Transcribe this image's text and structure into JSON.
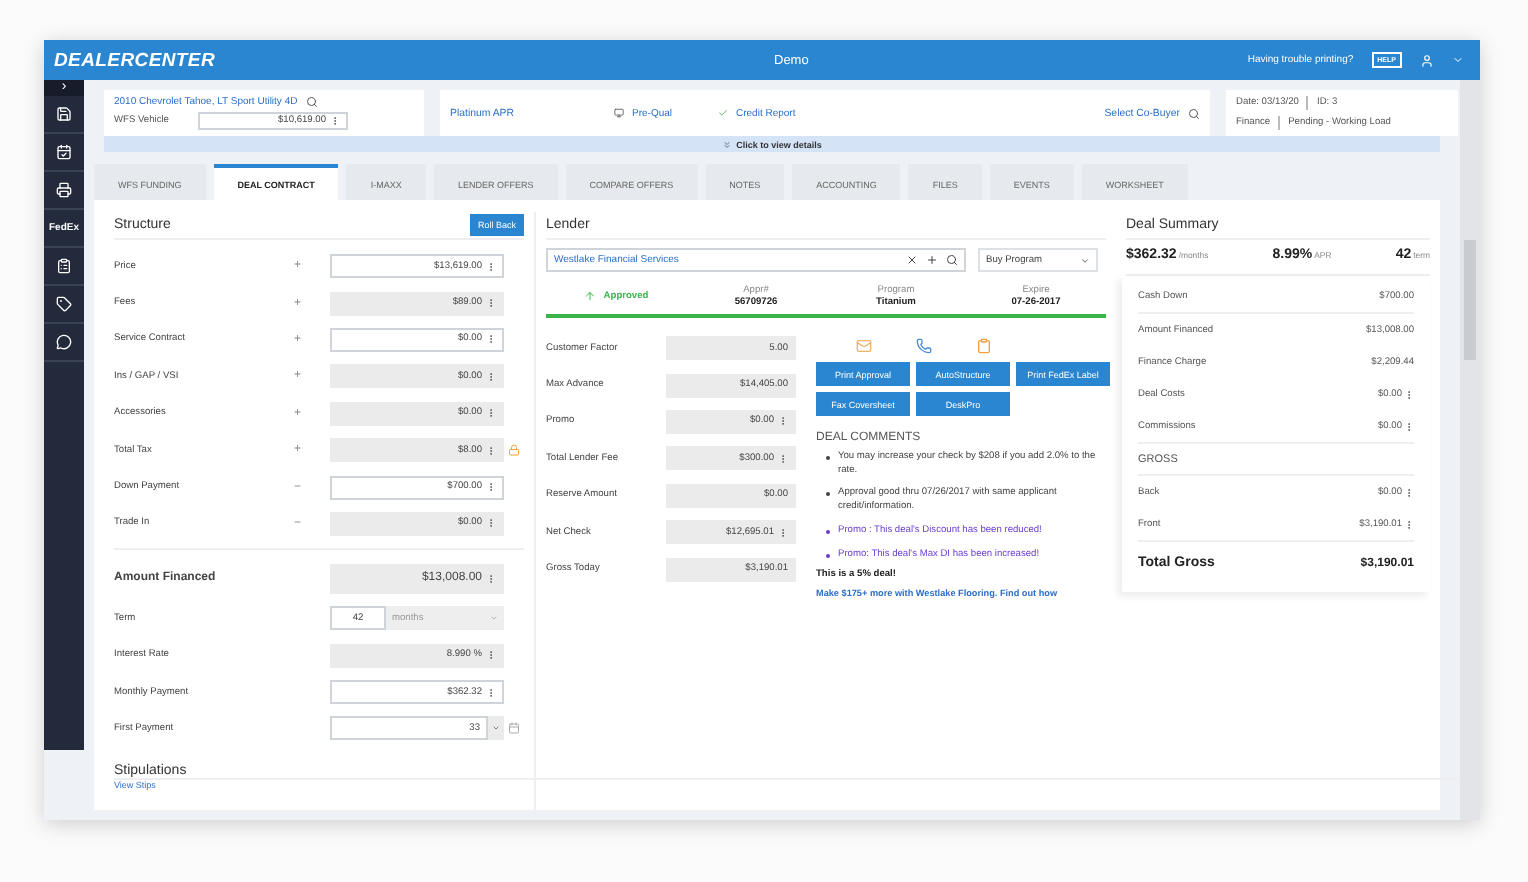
{
  "header": {
    "logo": "DEALERCENTER",
    "title": "Demo",
    "help_text": "Having trouble printing?",
    "help_badge": "HELP"
  },
  "sidebar": {
    "toggle": "›",
    "items": [
      {
        "kind": "icon"
      },
      {
        "kind": "icon"
      },
      {
        "kind": "icon"
      },
      {
        "kind": "text",
        "label": "FedEx"
      },
      {
        "kind": "icon"
      },
      {
        "kind": "icon"
      },
      {
        "kind": "icon"
      }
    ]
  },
  "vehicle": {
    "title": "2010 Chevrolet Tahoe, LT Sport Utility 4D",
    "label": "WFS Vehicle",
    "value": "$10,619.00"
  },
  "deal_bar": {
    "tier": "Platinum APR",
    "prequal": "Pre-Qual",
    "credit_report": "Credit Report",
    "co_buyer": "Select Co-Buyer"
  },
  "deal_info": {
    "date": "Date: 03/13/20",
    "id": "ID: 3",
    "department": "Finance",
    "status": "Pending - Working Load"
  },
  "details_toggle": "Click to view details",
  "tabs": [
    {
      "label": "WFS FUNDING",
      "selected": false
    },
    {
      "label": "DEAL CONTRACT",
      "selected": true
    },
    {
      "label": "I-MAXX",
      "selected": false
    },
    {
      "label": "LENDER OFFERS",
      "selected": false
    },
    {
      "label": "COMPARE OFFERS",
      "selected": false
    },
    {
      "label": "NOTES",
      "selected": false
    },
    {
      "label": "ACCOUNTING",
      "selected": false
    },
    {
      "label": "FILES",
      "selected": false
    },
    {
      "label": "EVENTS",
      "selected": false
    },
    {
      "label": "WORKSHEET",
      "selected": false
    }
  ],
  "structure": {
    "title": "Structure",
    "roll_back": "Roll Back",
    "rows": [
      {
        "label": "Price",
        "sign": "+",
        "value": "$13,619.00",
        "editable": true,
        "menu": true,
        "locked": false
      },
      {
        "label": "Fees",
        "sign": "+",
        "value": "$89.00",
        "editable": false,
        "menu": true,
        "locked": false
      },
      {
        "label": "Service Contract",
        "sign": "+",
        "value": "$0.00",
        "editable": true,
        "menu": true,
        "locked": false
      },
      {
        "label": "Ins / GAP / VSI",
        "sign": "+",
        "value": "$0.00",
        "editable": false,
        "menu": true,
        "locked": false
      },
      {
        "label": "Accessories",
        "sign": "+",
        "value": "$0.00",
        "editable": false,
        "menu": true,
        "locked": false
      },
      {
        "label": "Total Tax",
        "sign": "+",
        "value": "$8.00",
        "editable": false,
        "menu": true,
        "locked": true
      },
      {
        "label": "Down Payment",
        "sign": "−",
        "value": "$700.00",
        "editable": true,
        "menu": true,
        "locked": false
      },
      {
        "label": "Trade In",
        "sign": "−",
        "value": "$0.00",
        "editable": false,
        "menu": true,
        "locked": false
      }
    ],
    "amount_financed": {
      "label": "Amount Financed",
      "value": "$13,008.00"
    },
    "terms": [
      {
        "kind": "term",
        "label": "Term",
        "value": "42",
        "unit": "months"
      },
      {
        "kind": "money",
        "label": "Interest Rate",
        "value": "8.990 %",
        "editable": false
      },
      {
        "kind": "money",
        "label": "Monthly Payment",
        "value": "$362.32",
        "editable": true
      },
      {
        "kind": "date",
        "label": "First Payment",
        "value": "33"
      }
    ]
  },
  "stipulations": {
    "title": "Stipulations",
    "link": "View Stips"
  },
  "lender": {
    "title": "Lender",
    "search_value": "Westlake Financial Services",
    "program_select": "Buy Program",
    "status": "Approved",
    "meta": [
      {
        "label": "Appr#",
        "value": "56709726"
      },
      {
        "label": "Program",
        "value": "Titanium"
      },
      {
        "label": "Expire",
        "value": "07-26-2017"
      }
    ],
    "fields": [
      {
        "label": "Customer Factor",
        "value": "5.00",
        "menu": false
      },
      {
        "label": "Max Advance",
        "value": "$14,405.00",
        "menu": false
      },
      {
        "label": "Promo",
        "value": "$0.00",
        "menu": true
      },
      {
        "label": "Total Lender Fee",
        "value": "$300.00",
        "menu": true
      },
      {
        "label": "Reserve Amount",
        "value": "$0.00",
        "menu": false
      },
      {
        "label": "Net Check",
        "value": "$12,695.01",
        "menu": true
      },
      {
        "label": "Gross Today",
        "value": "$3,190.01",
        "menu": false
      }
    ],
    "buttons": [
      "Print Approval",
      "AutoStructure",
      "Print FedEx Label",
      "Fax Coversheet",
      "DeskPro"
    ],
    "comments_title": "DEAL COMMENTS",
    "comments": [
      {
        "kind": "note",
        "text": "You may increase your check by $208 if you add 2.0% to the rate."
      },
      {
        "kind": "note",
        "text": "Approval good thru 07/26/2017 with same applicant credit/information."
      },
      {
        "kind": "promo",
        "text": "Promo : This deal's Discount has been reduced!"
      },
      {
        "kind": "promo",
        "text": "Promo: This deal's Max DI has been increased!"
      }
    ],
    "deal_note": "This is a 5% deal!",
    "flooring_link": "Make $175+ more with Westlake Flooring. Find out how"
  },
  "summary": {
    "title": "Deal Summary",
    "stats": [
      {
        "value": "$362.32",
        "unit": "/months"
      },
      {
        "value": "8.99%",
        "unit": "APR"
      },
      {
        "value": "42",
        "unit": "term"
      }
    ],
    "groups": [
      {
        "rows": [
          {
            "label": "Cash Down",
            "value": "$700.00",
            "menu": false
          }
        ]
      },
      {
        "rows": [
          {
            "label": "Amount Financed",
            "value": "$13,008.00",
            "menu": false
          },
          {
            "label": "Finance Charge",
            "value": "$2,209.44",
            "menu": false
          },
          {
            "label": "Deal Costs",
            "value": "$0.00",
            "menu": true
          },
          {
            "label": "Commissions",
            "value": "$0.00",
            "menu": true
          }
        ]
      },
      {
        "title": "GROSS",
        "rows": [
          {
            "label": "Back",
            "value": "$0.00",
            "menu": true
          },
          {
            "label": "Front",
            "value": "$3,190.01",
            "menu": true
          }
        ]
      }
    ],
    "total": {
      "label": "Total Gross",
      "value": "$3,190.01"
    }
  }
}
